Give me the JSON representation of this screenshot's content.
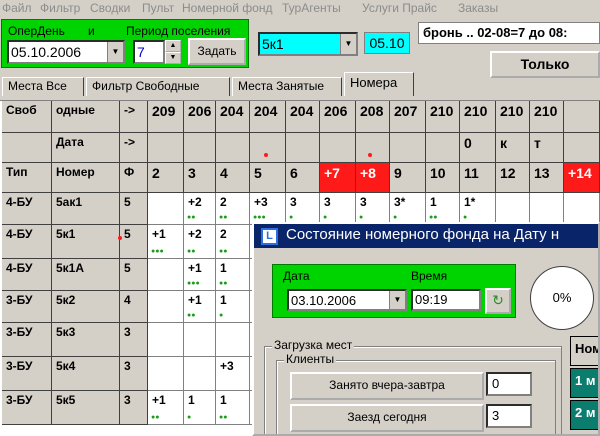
{
  "menu": [
    "Файл",
    "Фильтр",
    "Сводки",
    "Пульт",
    "Номерной фонд",
    "ТурАгенты",
    "Услуги Прайс",
    "Заказы"
  ],
  "toolbar": {
    "operday_label": "ОперДень",
    "and_label": "и",
    "period_label": "Период поселения",
    "operday_value": "05.10.2006",
    "period_value": "7",
    "set_button": "Задать",
    "room_value": "5к1",
    "room_code": "05.10",
    "booking_text": "бронь .. 02-08=7 до 08:",
    "only_button": "Только"
  },
  "tabs": [
    "Места Все",
    "Фильтр Свободные",
    "Места Занятые",
    "Номера"
  ],
  "grid": {
    "rows": [
      [
        "Своб",
        "одные",
        "->",
        "209",
        "206",
        "204",
        "204",
        "204",
        "206",
        "208",
        "207",
        "210",
        "210",
        "210",
        "210"
      ],
      [
        "",
        "Дата",
        "->",
        "",
        "",
        "",
        "",
        "",
        "",
        "",
        "",
        "",
        "0",
        "к",
        "т"
      ],
      [
        "Тип",
        "Номер",
        "Ф",
        "2",
        "3",
        "4",
        "5",
        "6",
        "+7",
        "+8",
        "9",
        "10",
        "11",
        "12",
        "13",
        "+14"
      ],
      [
        "4-БУ",
        "5ак1",
        "5",
        "",
        "+2",
        "2",
        "+3",
        "3",
        "3",
        "3",
        "3*",
        "1",
        "1*",
        "",
        ""
      ],
      [
        "4-БУ",
        "5к1",
        "5",
        "+1",
        "+2",
        "2",
        "",
        "",
        "",
        "",
        "",
        "",
        "",
        "",
        ""
      ],
      [
        "4-БУ",
        "5к1А",
        "5",
        "",
        "+1",
        "1",
        "",
        "",
        "",
        "",
        "",
        "",
        "",
        "",
        ""
      ],
      [
        "3-БУ",
        "5к2",
        "4",
        "",
        "+1",
        "1",
        "",
        "",
        "",
        "",
        "",
        "",
        "",
        "",
        ""
      ],
      [
        "3-БУ",
        "5к3",
        "3",
        "",
        "",
        "",
        "",
        "",
        "",
        "",
        "",
        "",
        "",
        "",
        ""
      ],
      [
        "3-БУ",
        "5к4",
        "3",
        "",
        "",
        "+3",
        "",
        "",
        "",
        "",
        "",
        "",
        "",
        "",
        ""
      ],
      [
        "3-БУ",
        "5к5",
        "3",
        "+1",
        "1",
        "1",
        "",
        "",
        "",
        "",
        "",
        "",
        "",
        "",
        ""
      ]
    ]
  },
  "dialog": {
    "title": "Состояние номерного фонда на Дату н",
    "date_label": "Дата",
    "time_label": "Время",
    "date_value": "03.10.2006",
    "time_value": "09:19",
    "percent": "0%",
    "load_group": "Загрузка мест",
    "clients_group": "Клиенты",
    "occupied_button": "Занято вчера-завтра",
    "occupied_value": "0",
    "checkin_button": "Заезд сегодня",
    "checkin_value": "3",
    "right_col": [
      "Ном",
      "1 м",
      "2 м"
    ]
  }
}
